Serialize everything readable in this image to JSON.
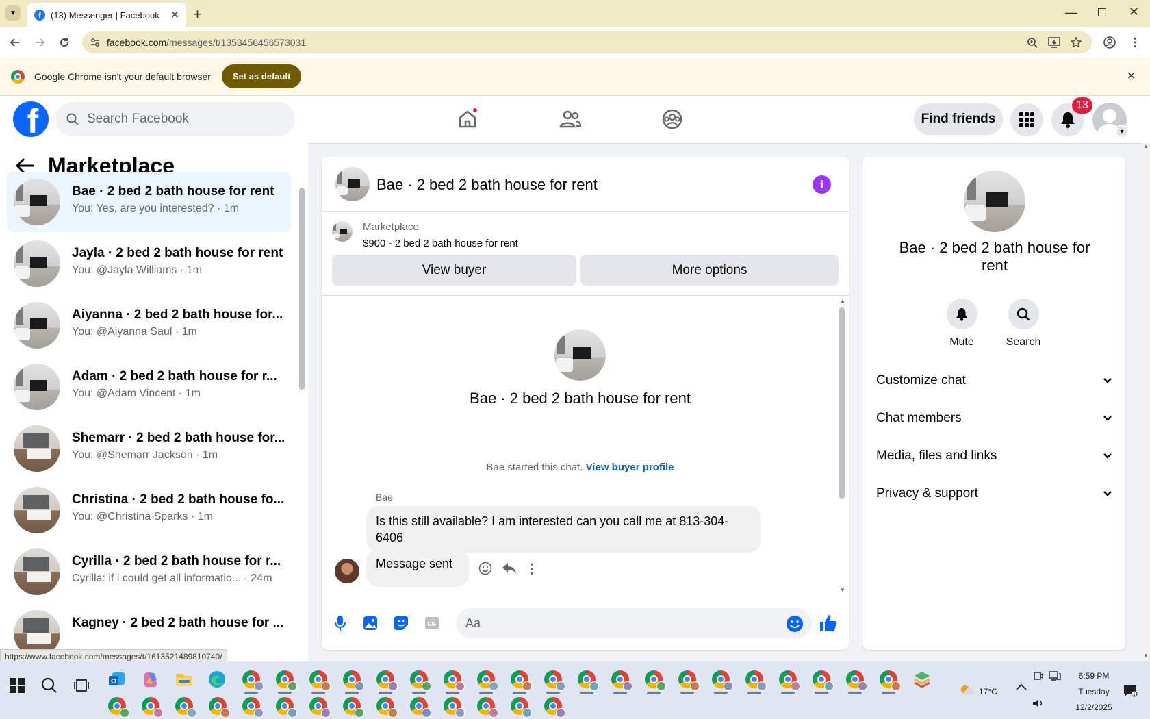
{
  "browser": {
    "tab_title": "(13) Messenger | Facebook",
    "url_host": "facebook.com",
    "url_path": "/messages/t/1353456456573031",
    "infobar_text": "Google Chrome isn't your default browser",
    "infobar_button": "Set as default"
  },
  "header": {
    "search_placeholder": "Search Facebook",
    "find_friends": "Find friends",
    "notification_count": "13"
  },
  "sidebar": {
    "title": "Marketplace",
    "conversations": [
      {
        "name": "Bae · 2 bed 2 bath house for rent",
        "preview": "You: Yes, are you interested? · 1m",
        "thumb": "room",
        "active": true
      },
      {
        "name": "Jayla · 2 bed 2 bath house for rent",
        "preview": "You: @Jayla Williams · 1m",
        "thumb": "room"
      },
      {
        "name": "Aiyanna · 2 bed 2 bath house for...",
        "preview": "You: @Aiyanna Saul · 1m",
        "thumb": "room"
      },
      {
        "name": "Adam · 2 bed 2 bath house for r...",
        "preview": "You: @Adam Vincent · 1m",
        "thumb": "room"
      },
      {
        "name": "Shemarr · 2 bed 2 bath house for...",
        "preview": "You: @Shemarr Jackson · 1m",
        "thumb": "kitchen"
      },
      {
        "name": "Christina · 2 bed 2 bath house fo...",
        "preview": "You: @Christina Sparks · 1m",
        "thumb": "kitchen"
      },
      {
        "name": "Cyrilla · 2 bed 2 bath house for r...",
        "preview": "Cyrilla: if i could get all informatio... · 24m",
        "thumb": "kitchen"
      },
      {
        "name": "Kagney · 2 bed 2 bath house for ...",
        "preview": "",
        "thumb": "kitchen"
      }
    ]
  },
  "chat": {
    "title": "Bae · 2 bed 2 bath house for rent",
    "listing_category": "Marketplace",
    "listing_price": "$900 - 2 bed 2 bath house for rent",
    "view_buyer": "View buyer",
    "more_options": "More options",
    "center_name": "Bae · 2 bed 2 bath house for rent",
    "started_text": "Bae started this chat.",
    "view_buyer_profile": "View buyer profile",
    "sender_name": "Bae",
    "message1": "Is this still available? I am interested can you call me at 813-304-6406",
    "message2": "Message sent",
    "input_placeholder": "Aa"
  },
  "details": {
    "name": "Bae · 2 bed 2 bath house for rent",
    "mute": "Mute",
    "search": "Search",
    "sections": [
      "Customize chat",
      "Chat members",
      "Media, files and links",
      "Privacy & support"
    ]
  },
  "status_url": "https://www.facebook.com/messages/t/1613521489810740/",
  "taskbar": {
    "temperature": "17°C",
    "time": "6:59 PM",
    "day": "Tuesday",
    "date": "12/2/2025"
  },
  "colors": {
    "fb_blue": "#0866ff",
    "accent_purple": "#a033ff",
    "badge_red": "#e41e3f",
    "active_row": "#ebf5ff"
  }
}
